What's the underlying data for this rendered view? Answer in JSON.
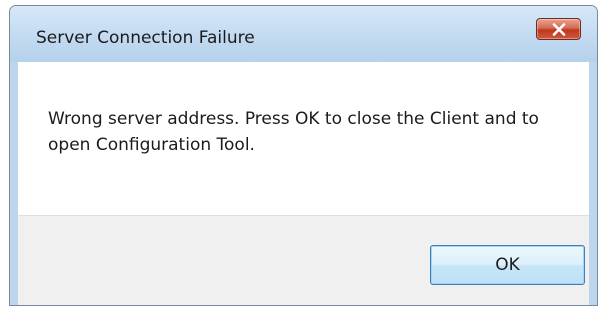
{
  "dialog": {
    "title": "Server Connection Failure",
    "close_icon": "close-x-icon",
    "message": "Wrong server address. Press OK to close the Client and to open Configuration Tool.",
    "ok_label": "OK"
  },
  "colors": {
    "titlebar": "#c3daf1",
    "close_button": "#c7432a",
    "ok_border": "#3c7fb1",
    "footer": "#f0f0f0"
  }
}
